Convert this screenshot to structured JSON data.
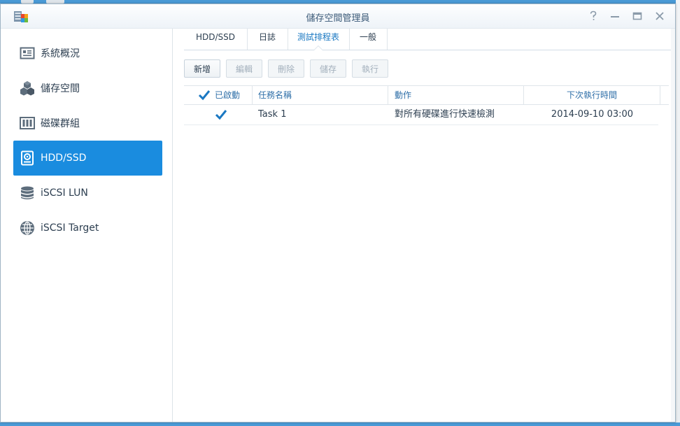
{
  "window": {
    "title": "儲存空間管理員"
  },
  "window_controls": {
    "help_icon": "question-icon",
    "minimize_icon": "minimize-icon",
    "maximize_icon": "maximize-icon",
    "close_icon": "close-icon"
  },
  "sidebar": {
    "items": [
      {
        "label": "系統概況",
        "icon": "overview-icon"
      },
      {
        "label": "儲存空間",
        "icon": "cubes-icon"
      },
      {
        "label": "磁碟群組",
        "icon": "disk-group-icon"
      },
      {
        "label": "HDD/SSD",
        "icon": "hdd-icon",
        "active": true
      },
      {
        "label": "iSCSI LUN",
        "icon": "database-icon"
      },
      {
        "label": "iSCSI Target",
        "icon": "globe-icon"
      }
    ]
  },
  "tabs": [
    {
      "label": "HDD/SSD"
    },
    {
      "label": "日誌"
    },
    {
      "label": "測試排程表",
      "active": true
    },
    {
      "label": "一般"
    }
  ],
  "toolbar": {
    "create": "新增",
    "edit": "編輯",
    "delete": "刪除",
    "save": "儲存",
    "run": "執行"
  },
  "table": {
    "columns": [
      "已啟動",
      "任務名稱",
      "動作",
      "下次執行時間"
    ],
    "rows": [
      {
        "enabled": true,
        "name": "Task 1",
        "action": "對所有硬碟進行快速檢測",
        "next_run": "2014-09-10 03:00"
      }
    ]
  },
  "colors": {
    "accent": "#1a8cdf",
    "checkmark": "#1a78c2"
  }
}
